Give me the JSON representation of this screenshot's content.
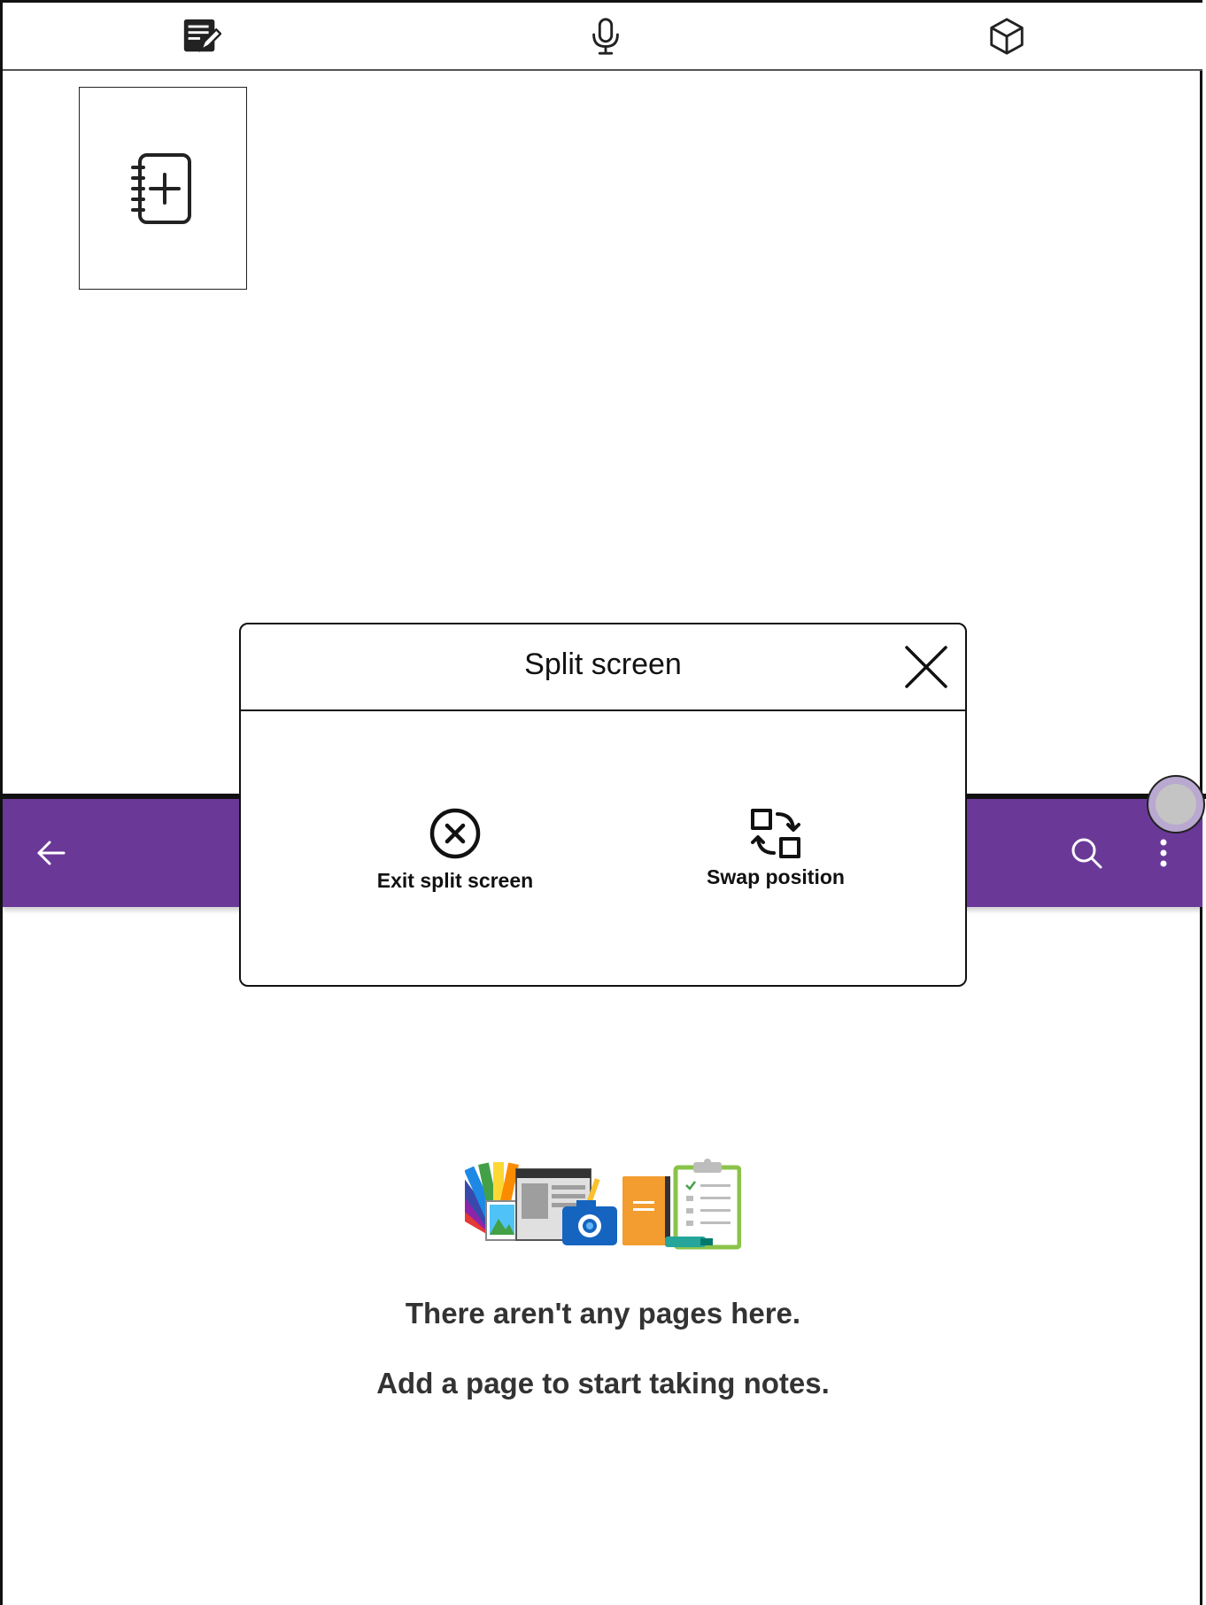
{
  "top_toolbar": {
    "icons": [
      "note-pen-icon",
      "microphone-icon",
      "cube-icon"
    ]
  },
  "notebook_tile": {
    "icon": "notebook-add-icon"
  },
  "app_bar": {
    "background": "#6a3998",
    "icons": [
      "arrow-back-icon",
      "search-icon",
      "more-vertical-icon"
    ]
  },
  "empty_state": {
    "title": "There aren't any pages here.",
    "subtitle": "Add a page to start taking notes."
  },
  "dialog": {
    "title": "Split screen",
    "close_icon": "close-icon",
    "options": [
      {
        "label": "Exit split screen",
        "icon": "circle-x-icon"
      },
      {
        "label": "Swap position",
        "icon": "swap-squares-icon"
      }
    ]
  }
}
